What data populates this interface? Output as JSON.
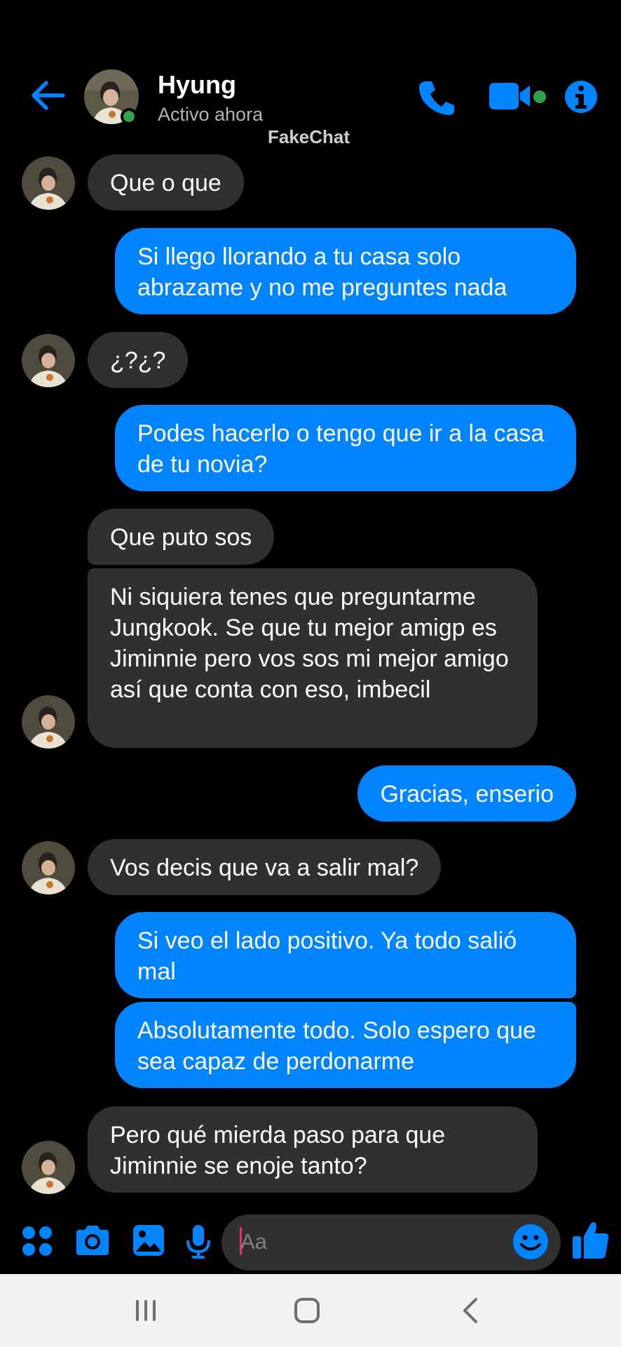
{
  "header": {
    "contact_name": "Hyung",
    "status": "Activo ahora",
    "watermark": "FakeChat",
    "back_icon": "arrow-left-icon",
    "call_icon": "phone-icon",
    "video_icon": "video-camera-icon",
    "info_icon": "info-icon"
  },
  "colors": {
    "accent": "#0084ff",
    "incoming_bubble": "#303030",
    "online": "#31a24c",
    "background": "#000000"
  },
  "messages": [
    {
      "from": "them",
      "text": "Que o que"
    },
    {
      "from": "me",
      "text": "Si llego llorando a tu casa solo abrazame y no me preguntes nada"
    },
    {
      "from": "them",
      "text": "¿?¿?"
    },
    {
      "from": "me",
      "text": "Podes hacerlo o tengo que ir a la casa de tu novia?"
    },
    {
      "from": "them",
      "text": "Que puto sos"
    },
    {
      "from": "them",
      "text": "Ni siquiera tenes que preguntarme Jungkook. Se que tu mejor amigp es Jiminnie pero vos sos mi mejor amigo así que conta con eso, imbecil"
    },
    {
      "from": "me",
      "text": "Gracias, enserio"
    },
    {
      "from": "them",
      "text": "Vos decis que va a salir mal?"
    },
    {
      "from": "me",
      "text": "Si veo el lado positivo. Ya todo salió mal"
    },
    {
      "from": "me",
      "text": "Absolutamente todo. Solo espero que sea capaz de perdonarme"
    },
    {
      "from": "them",
      "text": "Pero qué mierda paso para que Jiminnie se enoje tanto?"
    }
  ],
  "composer": {
    "placeholder": "Aa",
    "icons": [
      "apps-icon",
      "camera-icon",
      "gallery-icon",
      "microphone-icon",
      "emoji-icon",
      "thumbs-up-icon"
    ]
  },
  "navbar": {
    "icons": [
      "recent-apps-icon",
      "home-icon",
      "back-nav-icon"
    ]
  }
}
